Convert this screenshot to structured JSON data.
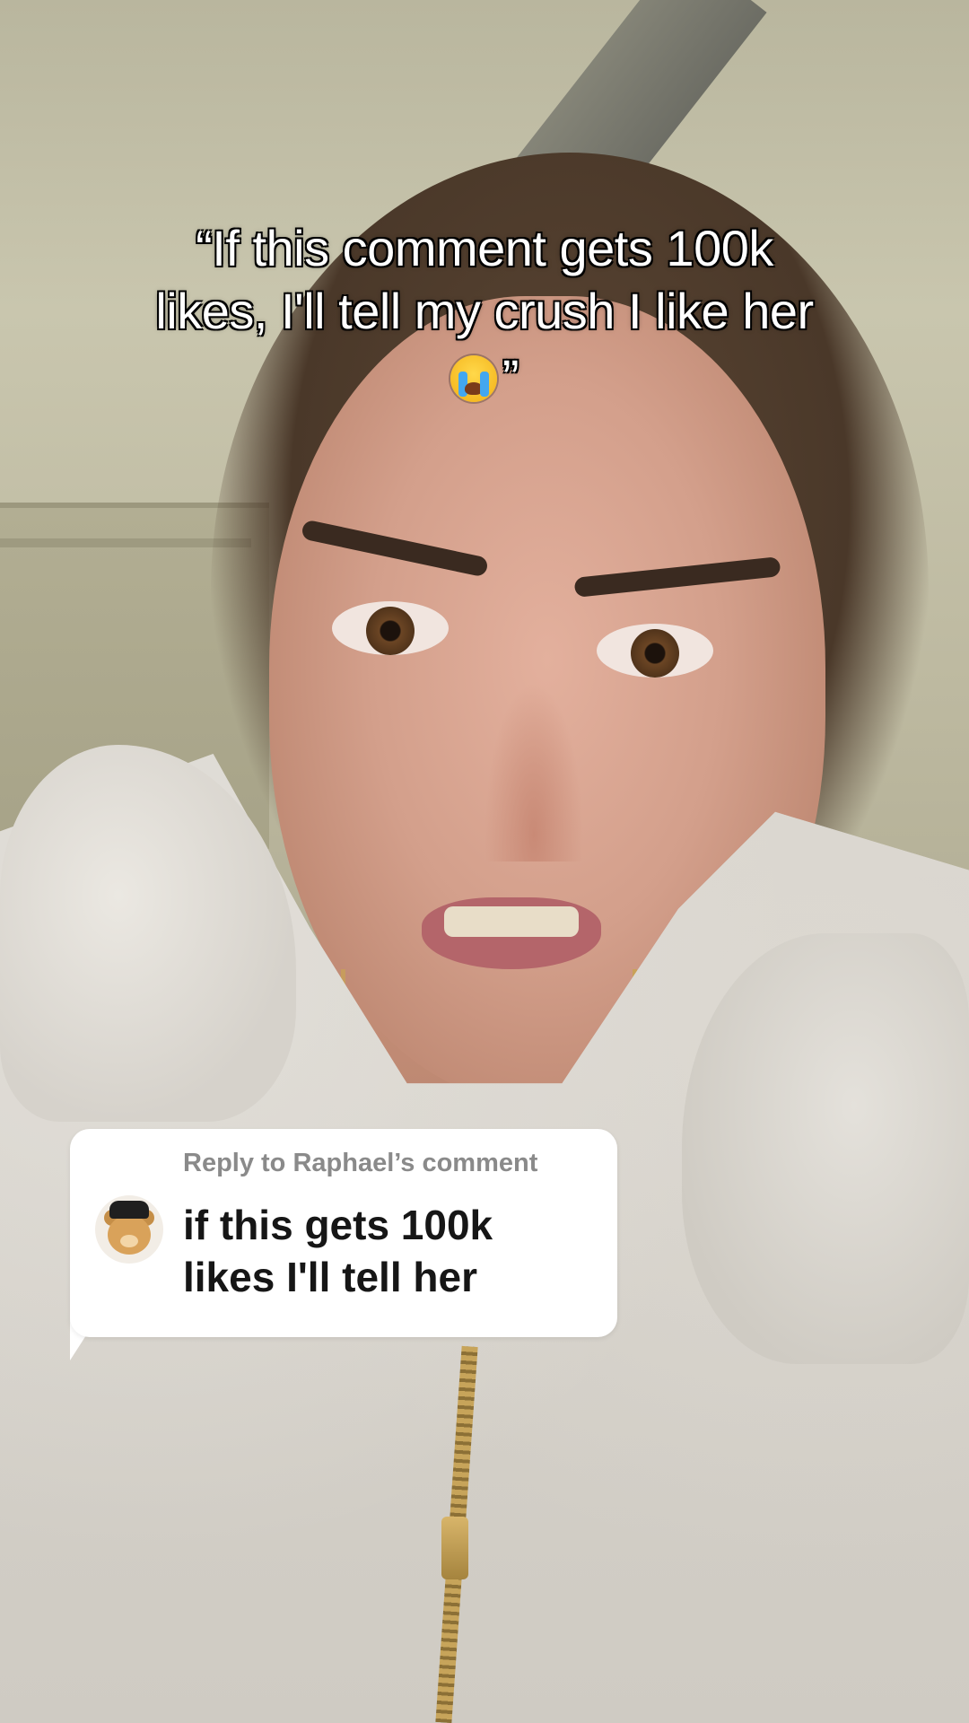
{
  "caption": {
    "line1": "“If this comment gets 100k",
    "line2": "likes, I'll tell my crush I like her",
    "line3_suffix": "”",
    "emoji": "loudly-crying-face-emoji"
  },
  "reply": {
    "header": "Reply to Raphael’s comment",
    "body_line1": "if this gets 100k",
    "body_line2": "likes I'll tell her",
    "avatar_icon": "teddy-bear-avatar"
  }
}
